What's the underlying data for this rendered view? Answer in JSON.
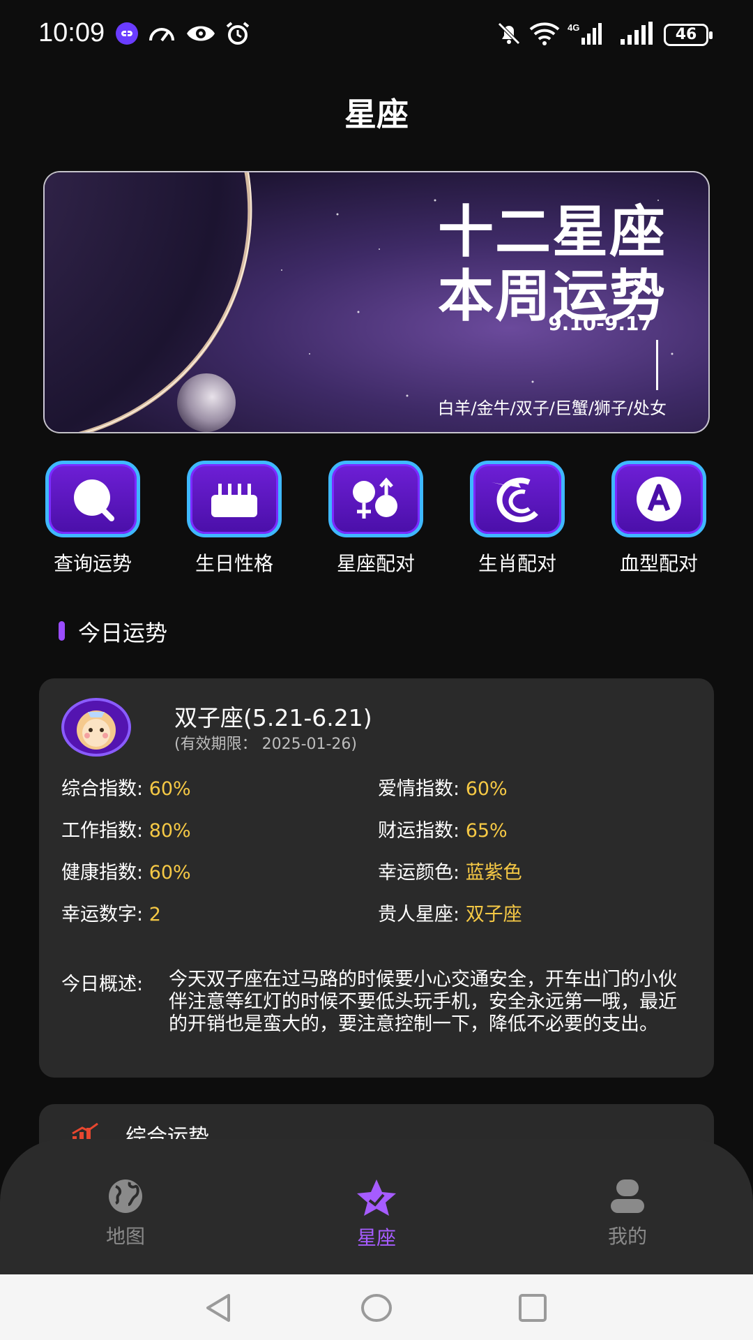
{
  "status_bar": {
    "time": "10:09",
    "battery": "46",
    "network": "4G"
  },
  "header": {
    "title": "星座"
  },
  "banner": {
    "title_line1": "十二星座",
    "title_line2": "本周运势",
    "date_range": "9.10-9.17",
    "signs": "白羊/金牛/双子/巨蟹/狮子/处女"
  },
  "quick_menu": [
    {
      "label": "查询运势",
      "icon": "search-icon"
    },
    {
      "label": "生日性格",
      "icon": "cake-icon"
    },
    {
      "label": "星座配对",
      "icon": "gender-match-icon"
    },
    {
      "label": "生肖配对",
      "icon": "dragon-icon"
    },
    {
      "label": "血型配对",
      "icon": "blood-type-icon"
    }
  ],
  "section": {
    "title": "今日运势"
  },
  "fortune": {
    "sign": "双子座(5.21-6.21)",
    "valid": "(有效期限： 2025-01-26)",
    "stats": [
      {
        "label": "综合指数: ",
        "value": "60%"
      },
      {
        "label": "爱情指数: ",
        "value": "60%"
      },
      {
        "label": "工作指数: ",
        "value": "80%"
      },
      {
        "label": "财运指数: ",
        "value": "65%"
      },
      {
        "label": "健康指数: ",
        "value": "60%"
      },
      {
        "label": "幸运颜色: ",
        "value": "蓝紫色"
      },
      {
        "label": "幸运数字: ",
        "value": "2"
      },
      {
        "label": "贵人星座: ",
        "value": "双子座"
      }
    ],
    "summary_label": "今日概述:",
    "summary": "今天双子座在过马路的时候要小心交通安全，开车出门的小伙伴注意等红灯的时候不要低头玩手机，安全永远第一哦，最近的开销也是蛮大的，要注意控制一下，降低不必要的支出。"
  },
  "next_card": {
    "title": "综合运势"
  },
  "bottom_nav": [
    {
      "label": "地图",
      "icon": "globe-icon",
      "active": false
    },
    {
      "label": "星座",
      "icon": "star-icon",
      "active": true
    },
    {
      "label": "我的",
      "icon": "user-icon",
      "active": false
    }
  ],
  "colors": {
    "accent": "#9b4dff",
    "value_yellow": "#f6c945",
    "card_bg": "#2a2a2a"
  }
}
